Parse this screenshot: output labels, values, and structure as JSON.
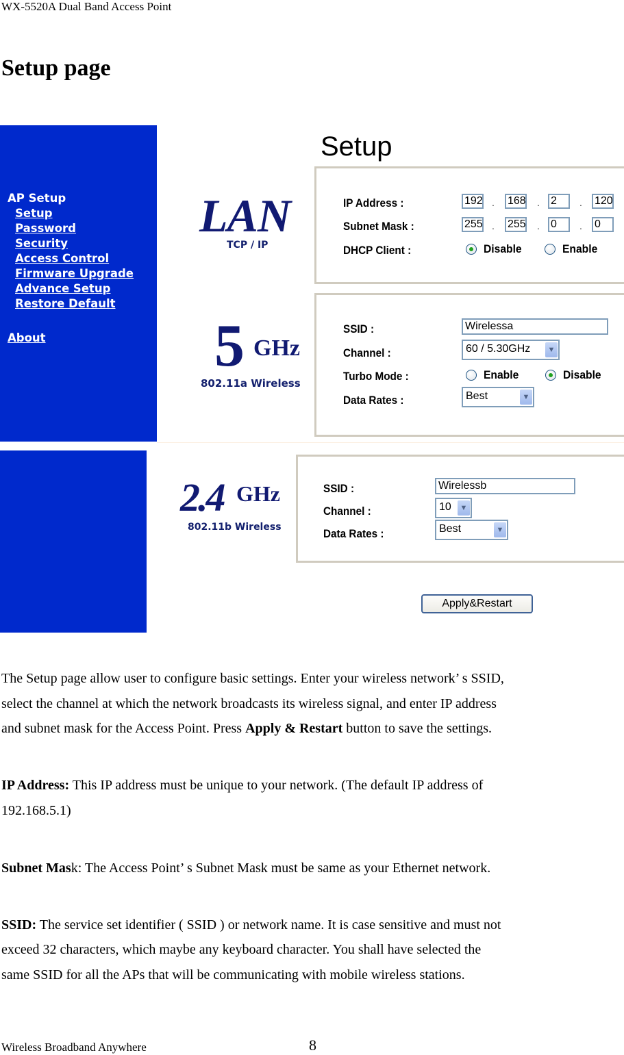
{
  "document": {
    "running_header": "WX-5520A Dual Band Access Point",
    "title": "Setup page",
    "footer_left": "Wireless Broadband Anywhere",
    "page_number": "8"
  },
  "screenshot": {
    "sidebar": {
      "heading": "AP Setup",
      "items": [
        {
          "label": "Setup"
        },
        {
          "label": "Password"
        },
        {
          "label": "Security"
        },
        {
          "label": "Access Control"
        },
        {
          "label": "Firmware Upgrade"
        },
        {
          "label": "Advance Setup"
        },
        {
          "label": "Restore Default"
        }
      ],
      "about": "About"
    },
    "heading": "Setup",
    "lan": {
      "logo_title": "LAN",
      "logo_sub": "TCP / IP",
      "ip_label": "IP Address :",
      "ip": [
        "192",
        "168",
        "2",
        "120"
      ],
      "mask_label": "Subnet Mask :",
      "mask": [
        "255",
        "255",
        "0",
        "0"
      ],
      "dhcp_label": "DHCP Client :",
      "dhcp_options": [
        "Disable",
        "Enable"
      ],
      "dhcp_selected": "Disable",
      "separator": "."
    },
    "wireless_5g": {
      "logo_number": "5",
      "logo_unit": "GHz",
      "logo_sub": "802.11a Wireless",
      "ssid_label": "SSID :",
      "ssid": "Wirelessa",
      "channel_label": "Channel :",
      "channel": "60 / 5.30GHz",
      "turbo_label": "Turbo Mode :",
      "turbo_options": [
        "Enable",
        "Disable"
      ],
      "turbo_selected": "Disable",
      "rates_label": "Data Rates :",
      "rates": "Best"
    },
    "wireless_24g": {
      "logo_number": "2.4",
      "logo_unit": "GHz",
      "logo_sub": "802.11b Wireless",
      "ssid_label": "SSID :",
      "ssid": "Wirelessb",
      "channel_label": "Channel :",
      "channel": "10",
      "rates_label": "Data Rates :",
      "rates": "Best"
    },
    "apply_button": "Apply&Restart",
    "dropdown_icon": "chevron-down-icon",
    "colors": {
      "sidebar_bg": "#0029cc",
      "logo_navy": "#111a72",
      "radio_selected": "#21a121",
      "input_border": "#7f9db9"
    }
  },
  "body": {
    "intro": {
      "line1": "The Setup page allow user to configure basic settings. Enter your wireless network’ s SSID,",
      "line2": "select the channel at which the network broadcasts its wireless signal, and enter IP address",
      "line3_pre": "and subnet mask for the Access Point. Press ",
      "line3_bold": "Apply & Restart",
      "line3_post": " button to save the settings."
    },
    "ip_address": {
      "term": "IP Address:",
      "line1": " This IP address must be unique to your network. (The default IP address of",
      "line2": "192.168.5.1)"
    },
    "subnet_mask": {
      "term": "Subnet Mas",
      "text": "k: The Access Point’ s Subnet Mask must be same as your Ethernet network."
    },
    "ssid": {
      "term": "SSID:",
      "line1": " The service set identifier ( SSID ) or network name. It is case sensitive and must not",
      "line2": "exceed 32 characters, which maybe any keyboard character. You shall have selected the",
      "line3": "same SSID for all the APs that will be communicating with mobile wireless stations."
    }
  }
}
